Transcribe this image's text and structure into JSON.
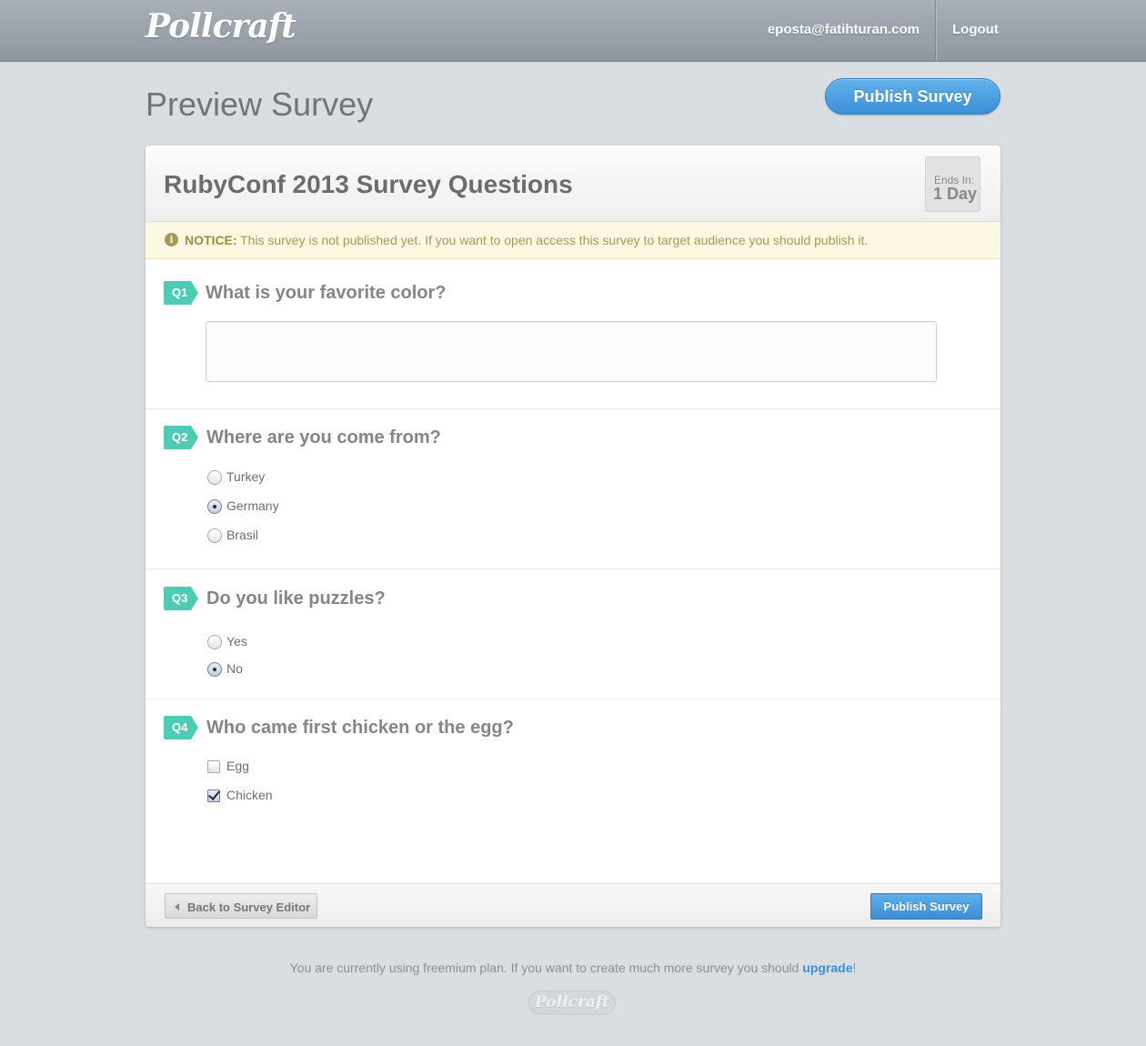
{
  "app": {
    "brand": "Pollcraft",
    "user_email": "eposta@fatihturan.com",
    "logout_label": "Logout"
  },
  "page": {
    "title": "Preview Survey",
    "publish_label": "Publish Survey"
  },
  "survey": {
    "title": "RubyConf 2013 Survey Questions",
    "ends_label": "Ends In:",
    "ends_value": "1 Day",
    "notice_strong": "NOTICE:",
    "notice_text": "This survey is not published yet. If you want to open access this survey to target audience you should publish it.",
    "notice_icon": "info-icon"
  },
  "questions": [
    {
      "badge": "Q1",
      "text": "What is your favorite color?",
      "type": "text",
      "value": ""
    },
    {
      "badge": "Q2",
      "text": "Where are you come from?",
      "type": "radio",
      "options": [
        {
          "label": "Turkey",
          "checked": false
        },
        {
          "label": "Germany",
          "checked": true
        },
        {
          "label": "Brasil",
          "checked": false
        }
      ]
    },
    {
      "badge": "Q3",
      "text": "Do you like puzzles?",
      "type": "radio",
      "options": [
        {
          "label": "Yes",
          "checked": false
        },
        {
          "label": "No",
          "checked": true
        }
      ]
    },
    {
      "badge": "Q4",
      "text": "Who came first chicken or the egg?",
      "type": "checkbox",
      "options": [
        {
          "label": "Egg",
          "checked": false
        },
        {
          "label": "Chicken",
          "checked": true
        }
      ]
    }
  ],
  "footer_actions": {
    "back_label": "Back to Survey Editor",
    "publish_label": "Publish Survey"
  },
  "footer": {
    "text": "You are currently using freemium plan. If you want to create much more survey you should ",
    "link": "upgrade",
    "end": "!",
    "logo": "Pollcraft"
  },
  "colors": {
    "accent": "#3c8fd6",
    "badge": "#4ecbb4",
    "notice_bg": "#fdf8e1"
  }
}
